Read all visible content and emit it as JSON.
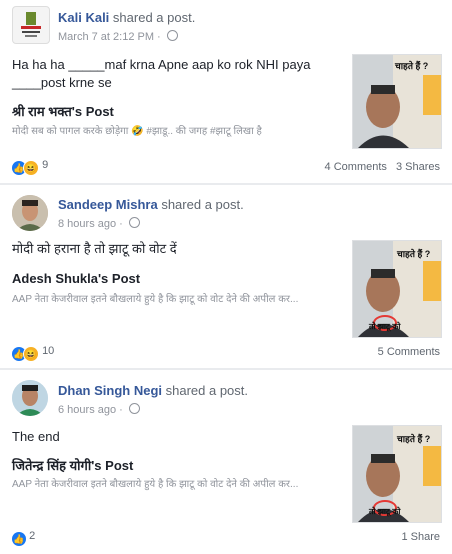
{
  "posts": [
    {
      "name": "Kali Kali",
      "action": "shared a post.",
      "time": "March 7 at 2:12 PM",
      "text": "Ha ha ha _____maf krna Apne aap ko rok NHI paya ____post krne se",
      "orig_title": "श्री राम भक्त's Post",
      "orig_snippet": "मोदी सब को पागल करके छोड़ेगा 🤣 #झाडू.. की जगह #झाटू लिखा है",
      "reaction_count": "9",
      "comments": "4 Comments",
      "shares": "3 Shares"
    },
    {
      "name": "Sandeep Mishra",
      "action": "shared a post.",
      "time": "8 hours ago",
      "text": "मोदी को हराना है तो झाटू को वोट दें",
      "orig_title": "Adesh Shukla's Post",
      "orig_snippet": "AAP नेता केजरीवाल इतने बौखलाये हुये है कि झाटू को वोट देने की अपील कर...",
      "reaction_count": "10",
      "comments": "5 Comments",
      "shares": ""
    },
    {
      "name": "Dhan Singh Negi",
      "action": "shared a post.",
      "time": "6 hours ago",
      "text": "The end",
      "orig_title": "जितेन्द्र सिंह योगी's Post",
      "orig_snippet": "AAP नेता केजरीवाल इतने बौखलाये हुये है कि झाटू को वोट देने की अपील कर...",
      "reaction_count": "2",
      "comments": "",
      "shares": "1 Share"
    }
  ],
  "thumb_caption_top": "चाहते हैं ?",
  "thumb_caption_bottom": "तो झाटू को"
}
